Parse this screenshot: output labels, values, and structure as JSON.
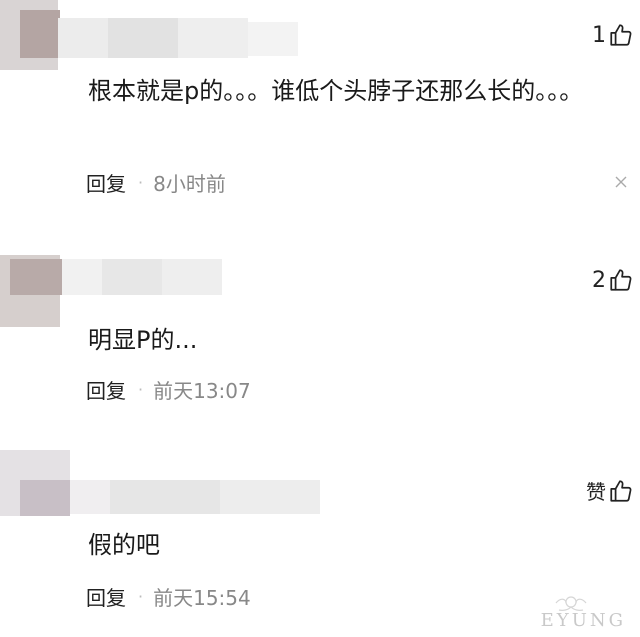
{
  "comments": [
    {
      "likes": "1",
      "text": "根本就是p的。。。谁低个头脖子还那么长的。。。",
      "reply_label": "回复",
      "dot": "·",
      "time": "8小时前"
    },
    {
      "likes": "2",
      "text": "明显P的...",
      "reply_label": "回复",
      "dot": "·",
      "time": "前天13:07"
    },
    {
      "likes": "赞",
      "text": "假的吧",
      "reply_label": "回复",
      "dot": "·",
      "time": "前天15:54"
    }
  ],
  "watermark": {
    "text": "EYUNG"
  },
  "icons": {
    "like": "thumbs-up-icon",
    "close": "close-icon"
  },
  "colors": {
    "text": "#1a1a1a",
    "muted": "#888888",
    "blur_light": "#eeeeee",
    "blur_mid": "#dcdcdc",
    "blur_dark": "#b8aaa8"
  }
}
